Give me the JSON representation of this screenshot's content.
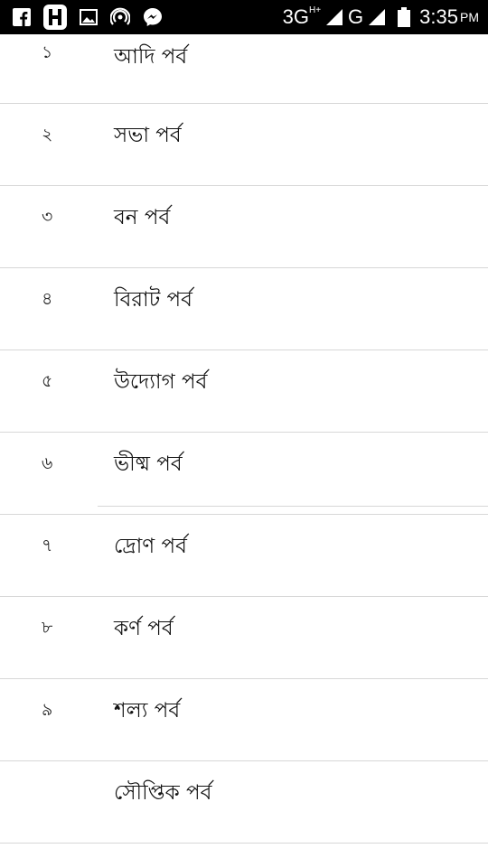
{
  "status_bar": {
    "icons_left": [
      "facebook-icon",
      "app-h-icon",
      "gallery-icon",
      "hotspot-icon",
      "messenger-icon"
    ],
    "network_1": "3G",
    "network_1_sup": "H+",
    "network_2": "G",
    "time": "3:35",
    "ampm": "PM"
  },
  "parvas": [
    {
      "number": "১",
      "title": "আদি পর্ব"
    },
    {
      "number": "২",
      "title": "সভা পর্ব"
    },
    {
      "number": "৩",
      "title": "বন পর্ব"
    },
    {
      "number": "৪",
      "title": "বিরাট পর্ব"
    },
    {
      "number": "৫",
      "title": "উদ্যোগ পর্ব"
    },
    {
      "number": "৬",
      "title": "ভীষ্ম পর্ব"
    },
    {
      "number": "৭",
      "title": "দ্রোণ পর্ব"
    },
    {
      "number": "৮",
      "title": "কর্ণ পর্ব"
    },
    {
      "number": "৯",
      "title": "শল্য পর্ব"
    },
    {
      "number": "",
      "title": "সৌপ্তিক পর্ব"
    }
  ]
}
